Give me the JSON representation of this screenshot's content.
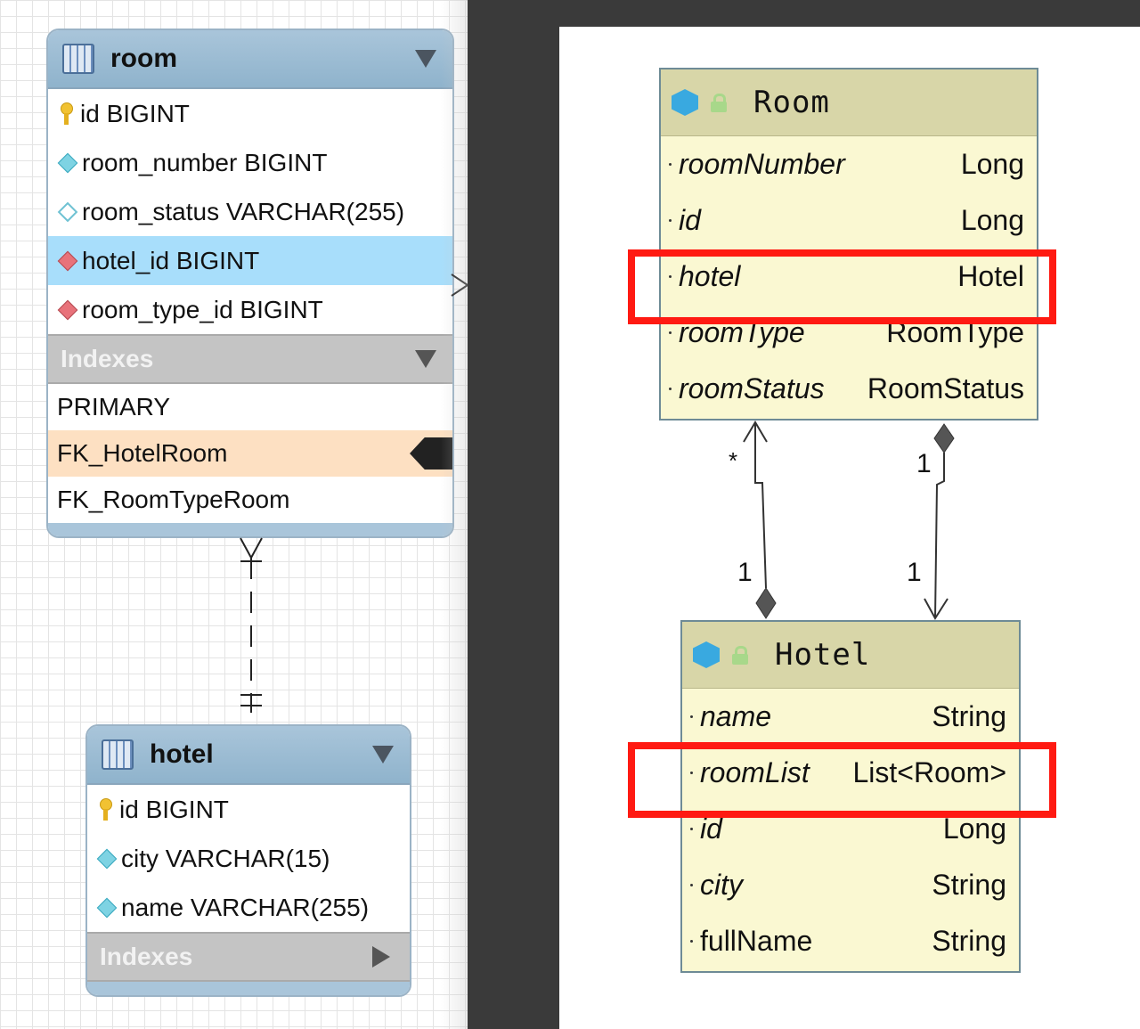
{
  "er": {
    "room": {
      "title": "room",
      "columns": [
        {
          "label": "id BIGINT",
          "icon": "primary-key-icon"
        },
        {
          "label": "room_number BIGINT",
          "icon": "column-diamond-icon"
        },
        {
          "label": "room_status VARCHAR(255)",
          "icon": "nullable-column-diamond-icon"
        },
        {
          "label": "hotel_id BIGINT",
          "icon": "foreign-key-diamond-icon"
        },
        {
          "label": "room_type_id BIGINT",
          "icon": "foreign-key-diamond-icon"
        }
      ],
      "indexes_label": "Indexes",
      "indexes": [
        "PRIMARY",
        "FK_HotelRoom",
        "FK_RoomTypeRoom"
      ]
    },
    "hotel": {
      "title": "hotel",
      "columns": [
        {
          "label": "id BIGINT",
          "icon": "primary-key-icon"
        },
        {
          "label": "city VARCHAR(15)",
          "icon": "column-diamond-icon"
        },
        {
          "label": "name VARCHAR(255)",
          "icon": "column-diamond-icon"
        }
      ],
      "indexes_label": "Indexes"
    }
  },
  "uml": {
    "room": {
      "name": "Room",
      "fields": [
        {
          "name": "roomNumber",
          "type": "Long"
        },
        {
          "name": "id",
          "type": "Long"
        },
        {
          "name": "hotel",
          "type": "Hotel"
        },
        {
          "name": "roomType",
          "type": "RoomType"
        },
        {
          "name": "roomStatus",
          "type": "RoomStatus"
        }
      ]
    },
    "hotel": {
      "name": "Hotel",
      "fields": [
        {
          "name": "name",
          "type": "String"
        },
        {
          "name": "roomList",
          "type": "List<Room>"
        },
        {
          "name": "id",
          "type": "Long"
        },
        {
          "name": "city",
          "type": "String"
        },
        {
          "name": "fullName",
          "type": "String"
        }
      ]
    },
    "associations": {
      "left_top": "*",
      "left_bottom": "1",
      "right_top": "1",
      "right_bottom": "1"
    }
  },
  "colors": {
    "highlight_box": "#ff1a12",
    "er_selected_row": "#a8defb",
    "er_selected_index": "#fde0c2",
    "uml_class_fill": "#faf8d2",
    "uml_header_fill": "#d8d6a8"
  }
}
